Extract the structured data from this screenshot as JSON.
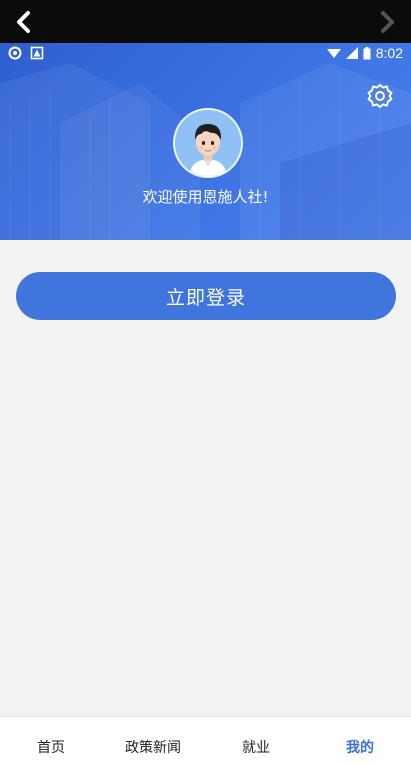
{
  "nav": {
    "back_icon": "chevron-left-icon",
    "forward_icon": "chevron-right-icon"
  },
  "status": {
    "time": "8:02"
  },
  "header": {
    "welcome_text": "欢迎使用恩施人社!",
    "settings_icon": "gear-icon"
  },
  "login": {
    "label": "立即登录"
  },
  "tabs": [
    {
      "label": "首页"
    },
    {
      "label": "政策新闻"
    },
    {
      "label": "就业"
    },
    {
      "label": "我的",
      "active": true
    }
  ],
  "colors": {
    "brand": "#3f75dc",
    "active_tab": "#3a6fd8",
    "background": "#f2f2f2"
  }
}
